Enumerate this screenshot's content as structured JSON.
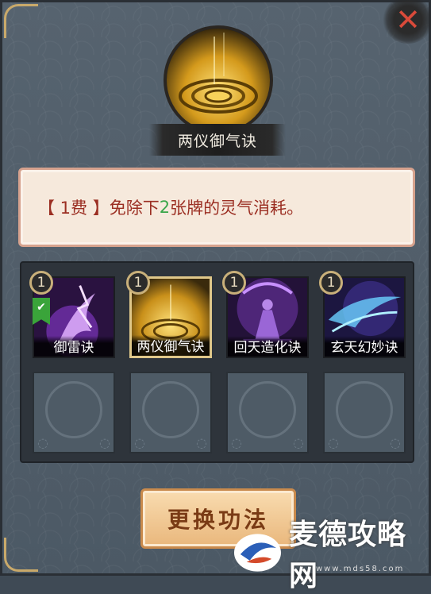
{
  "header": {
    "skill_name": "两仪御气诀"
  },
  "description": {
    "prefix": "【 1费 】免除下",
    "highlight": "2",
    "suffix": "张牌的灵气消耗。"
  },
  "cards": [
    {
      "cost": "1",
      "name": "御雷诀",
      "selected": false,
      "checked": true
    },
    {
      "cost": "1",
      "name": "两仪御气诀",
      "selected": true,
      "checked": false
    },
    {
      "cost": "1",
      "name": "回天造化诀",
      "selected": false,
      "checked": false
    },
    {
      "cost": "1",
      "name": "玄天幻妙诀",
      "selected": false,
      "checked": false
    }
  ],
  "empty_slots": 4,
  "swap_button": {
    "label": "更换功法"
  },
  "watermark": {
    "text": "麦德攻略网",
    "url": "www.mds58.com"
  },
  "close_icon": "close-x-icon",
  "colors": {
    "accent_red": "#9b2e22",
    "highlight_green": "#3aa64a",
    "gold": "#e0c88a"
  }
}
